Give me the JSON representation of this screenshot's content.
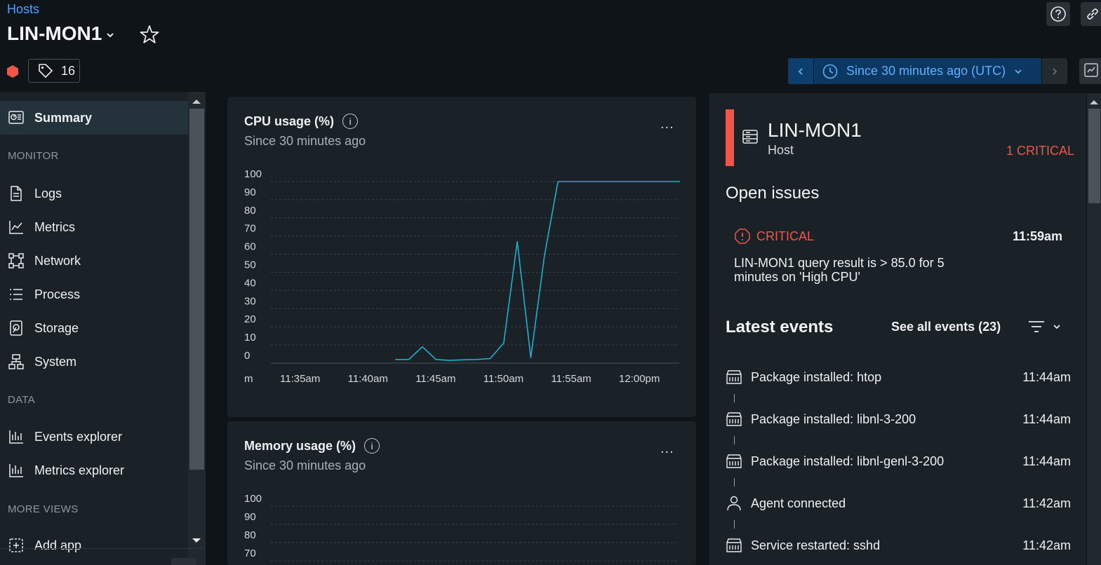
{
  "header": {
    "breadcrumb": "Hosts",
    "title": "LIN-MON1",
    "tag_count": "16",
    "time_range": "Since 30 minutes ago (UTC)"
  },
  "sidebar": {
    "active": "Summary",
    "sections": [
      {
        "heading": "MONITOR",
        "items": [
          "Logs",
          "Metrics",
          "Network",
          "Process",
          "Storage",
          "System"
        ]
      },
      {
        "heading": "DATA",
        "items": [
          "Events explorer",
          "Metrics explorer"
        ]
      },
      {
        "heading": "MORE VIEWS",
        "items": [
          "Add app"
        ]
      }
    ],
    "summary_label": "Summary",
    "monitor_heading": "MONITOR",
    "data_heading": "DATA",
    "more_heading": "MORE VIEWS",
    "items": {
      "logs": "Logs",
      "metrics": "Metrics",
      "network": "Network",
      "process": "Process",
      "storage": "Storage",
      "system": "System",
      "events_explorer": "Events explorer",
      "metrics_explorer": "Metrics explorer",
      "add_app": "Add app"
    }
  },
  "cpu_card": {
    "title": "CPU usage (%)",
    "subtitle": "Since 30 minutes ago",
    "menu": "..."
  },
  "memory_card": {
    "title": "Memory usage (%)",
    "subtitle": "Since 30 minutes ago",
    "menu": "...",
    "y_ticks_visible": [
      "100",
      "90",
      "80",
      "70"
    ]
  },
  "chart_data": [
    {
      "type": "line",
      "title": "CPU usage (%)",
      "subtitle": "Since 30 minutes ago",
      "xlabel": "",
      "ylabel": "",
      "ylim": [
        0,
        100
      ],
      "y_ticks": [
        "100",
        "90",
        "80",
        "70",
        "60",
        "50",
        "40",
        "30",
        "20",
        "10",
        "0"
      ],
      "x_ticks": [
        "m",
        "11:35am",
        "11:40am",
        "11:45am",
        "11:50am",
        "11:55am",
        "12:00pm"
      ],
      "grid": true,
      "line_color": "#1cb0d0",
      "series": [
        {
          "x": [
            "11:42am",
            "11:43am",
            "11:44am",
            "11:45am",
            "11:46am",
            "11:47am",
            "11:48am",
            "11:49am",
            "11:50am",
            "11:51am",
            "11:52am",
            "11:53am",
            "11:54am",
            "11:55am",
            "11:56am",
            "11:57am",
            "11:58am",
            "11:59am",
            "12:00pm",
            "12:01pm",
            "12:02pm",
            "12:03pm"
          ],
          "values": [
            2,
            2,
            9,
            2,
            1.5,
            1.8,
            2,
            2.5,
            11,
            67,
            3,
            59,
            100,
            100,
            100,
            100,
            100,
            100,
            100,
            100,
            100,
            100
          ]
        }
      ]
    }
  ],
  "entity": {
    "name": "LIN-MON1",
    "type": "Host",
    "alert_summary": "1 CRITICAL",
    "status_color": "#f0554a"
  },
  "issues": {
    "heading": "Open issues",
    "items": [
      {
        "severity": "CRITICAL",
        "time": "11:59am",
        "text": "LIN-MON1 query result is > 85.0 for 5 minutes on 'High CPU'"
      }
    ]
  },
  "events": {
    "heading": "Latest events",
    "see_all": "See all events (23)",
    "items": [
      {
        "icon": "package-icon",
        "label": "Package installed: htop",
        "time": "11:44am"
      },
      {
        "icon": "package-icon",
        "label": "Package installed: libnl-3-200",
        "time": "11:44am"
      },
      {
        "icon": "package-icon",
        "label": "Package installed: libnl-genl-3-200",
        "time": "11:44am"
      },
      {
        "icon": "agent-icon",
        "label": "Agent connected",
        "time": "11:42am"
      },
      {
        "icon": "package-icon",
        "label": "Service restarted: sshd",
        "time": "11:42am"
      }
    ]
  },
  "colors": {
    "accent": "#4ea0ff",
    "critical": "#f0554a",
    "line": "#1cb0d0",
    "background": "#0f1418",
    "panel": "#1b2227"
  }
}
